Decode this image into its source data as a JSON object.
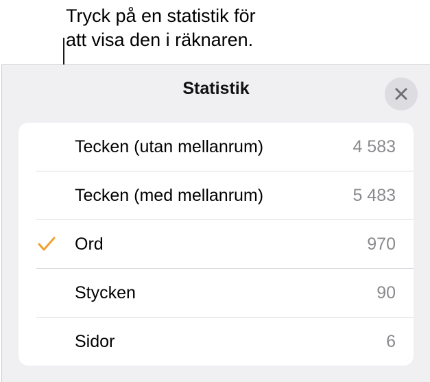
{
  "callout": {
    "line1": "Tryck på en statistik för",
    "line2": "att visa den i räknaren."
  },
  "popover": {
    "title": "Statistik",
    "close_icon": "close-icon",
    "rows": [
      {
        "label": "Tecken (utan mellanrum)",
        "value": "4 583",
        "checked": false
      },
      {
        "label": "Tecken (med mellanrum)",
        "value": "5 483",
        "checked": false
      },
      {
        "label": "Ord",
        "value": "970",
        "checked": true
      },
      {
        "label": "Stycken",
        "value": "90",
        "checked": false
      },
      {
        "label": "Sidor",
        "value": "6",
        "checked": false
      }
    ]
  },
  "colors": {
    "accent_check": "#f0a030",
    "value_text": "#8a8a8e",
    "popover_bg": "#f0f0f3"
  }
}
